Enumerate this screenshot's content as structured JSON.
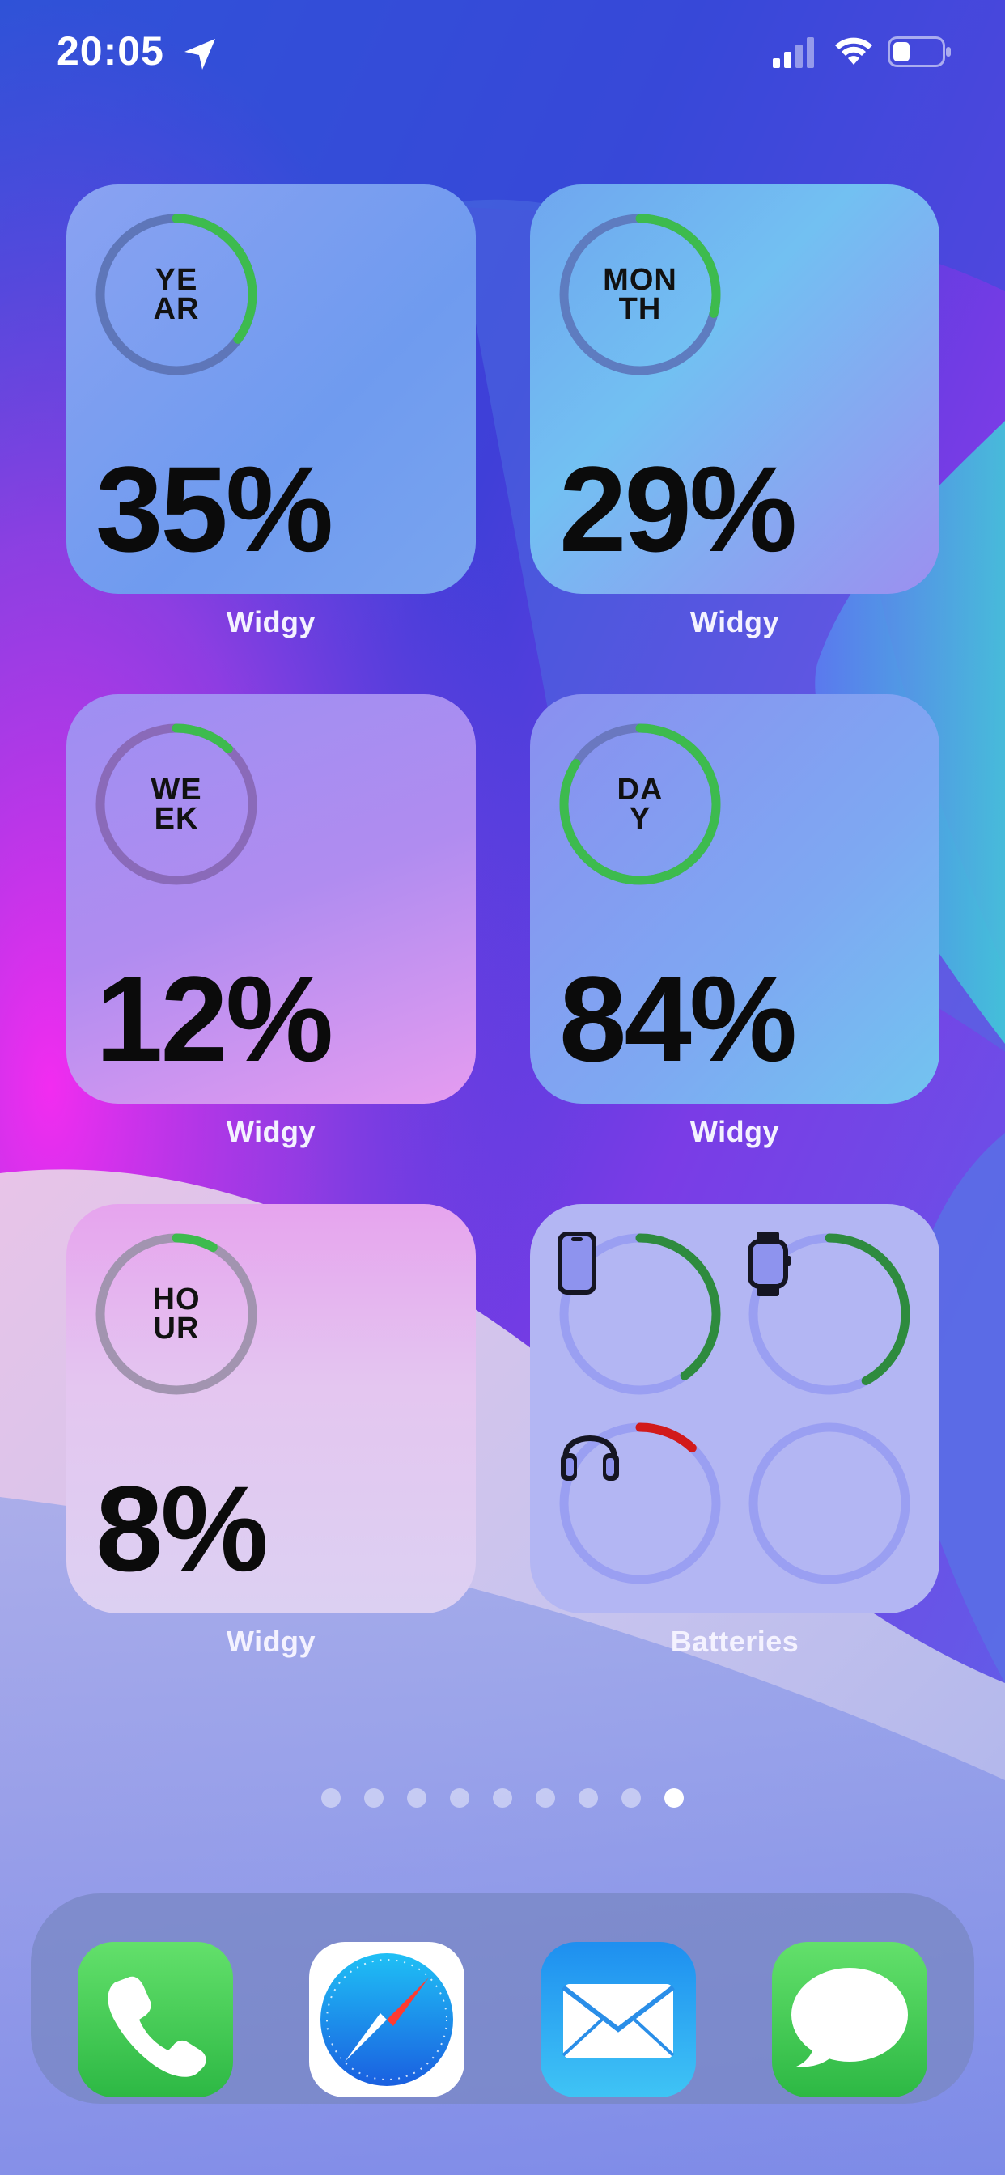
{
  "status_bar": {
    "time": "20:05",
    "icons": [
      "location-arrow-icon",
      "cellular-signal-icon",
      "wifi-icon",
      "battery-icon"
    ]
  },
  "widgets": [
    {
      "ring_label": "YE\nAR",
      "percent": "35%",
      "progress": 0.35,
      "app_label": "Widgy"
    },
    {
      "ring_label": "MON\nTH",
      "percent": "29%",
      "progress": 0.29,
      "app_label": "Widgy"
    },
    {
      "ring_label": "WE\nEK",
      "percent": "12%",
      "progress": 0.12,
      "app_label": "Widgy"
    },
    {
      "ring_label": "DA\nY",
      "percent": "84%",
      "progress": 0.84,
      "app_label": "Widgy"
    },
    {
      "ring_label": "HO\nUR",
      "percent": "8%",
      "progress": 0.08,
      "app_label": "Widgy"
    }
  ],
  "batteries_widget": {
    "app_label": "Batteries",
    "devices": [
      {
        "icon": "iphone-icon",
        "level": 0.4,
        "color": "#2e8b3e"
      },
      {
        "icon": "apple-watch-icon",
        "level": 0.42,
        "color": "#2e8b3e"
      },
      {
        "icon": "airpods-max-icon",
        "level": 0.12,
        "color": "#d21a1a"
      },
      {
        "icon": "empty-slot",
        "level": 0
      }
    ]
  },
  "page_dots": {
    "count": 9,
    "active_index": 8
  },
  "dock": {
    "apps": [
      "phone-app-icon",
      "safari-app-icon",
      "mail-app-icon",
      "messages-app-icon"
    ]
  },
  "colors": {
    "ring_green": "#3dbb4e",
    "battery_green": "#2e8b3e",
    "battery_red": "#d21a1a"
  }
}
